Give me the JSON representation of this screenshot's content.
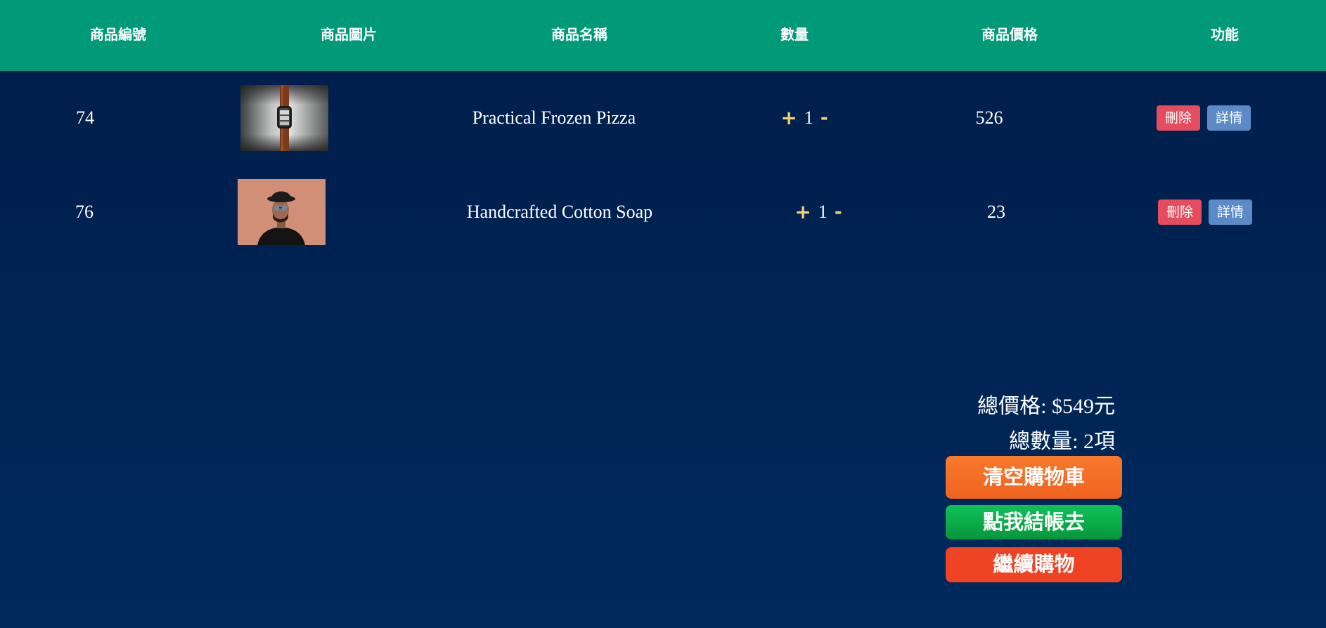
{
  "header": {
    "columns": [
      "商品編號",
      "商品圖片",
      "商品名稱",
      "數量",
      "商品價格",
      "功能"
    ]
  },
  "colors": {
    "header_bg": "#009a78",
    "background": "#001d4a",
    "qty_controls": "#f2d572",
    "delete_button": "#e54c5e",
    "detail_button": "#5b8ac7",
    "clear_cart_button": "#f26a25",
    "checkout_button": "#0aab48",
    "continue_button": "#ef4423"
  },
  "items": [
    {
      "id": "74",
      "image": "watch-photo",
      "name": "Practical Frozen Pizza",
      "plus": "+",
      "quantity": "1",
      "minus": "-",
      "price": "526",
      "delete_label": "刪除",
      "detail_label": "詳情"
    },
    {
      "id": "76",
      "image": "man-in-hat-photo",
      "name": "Handcrafted Cotton Soap",
      "plus": "+",
      "quantity": "1",
      "minus": "-",
      "price": "23",
      "delete_label": "刪除",
      "detail_label": "詳情"
    }
  ],
  "summary": {
    "total_price": "總價格: $549元",
    "total_count": "總數量: 2項"
  },
  "actions": {
    "clear_cart": "清空購物車",
    "checkout": "點我結帳去",
    "continue_shopping": "繼續購物"
  }
}
